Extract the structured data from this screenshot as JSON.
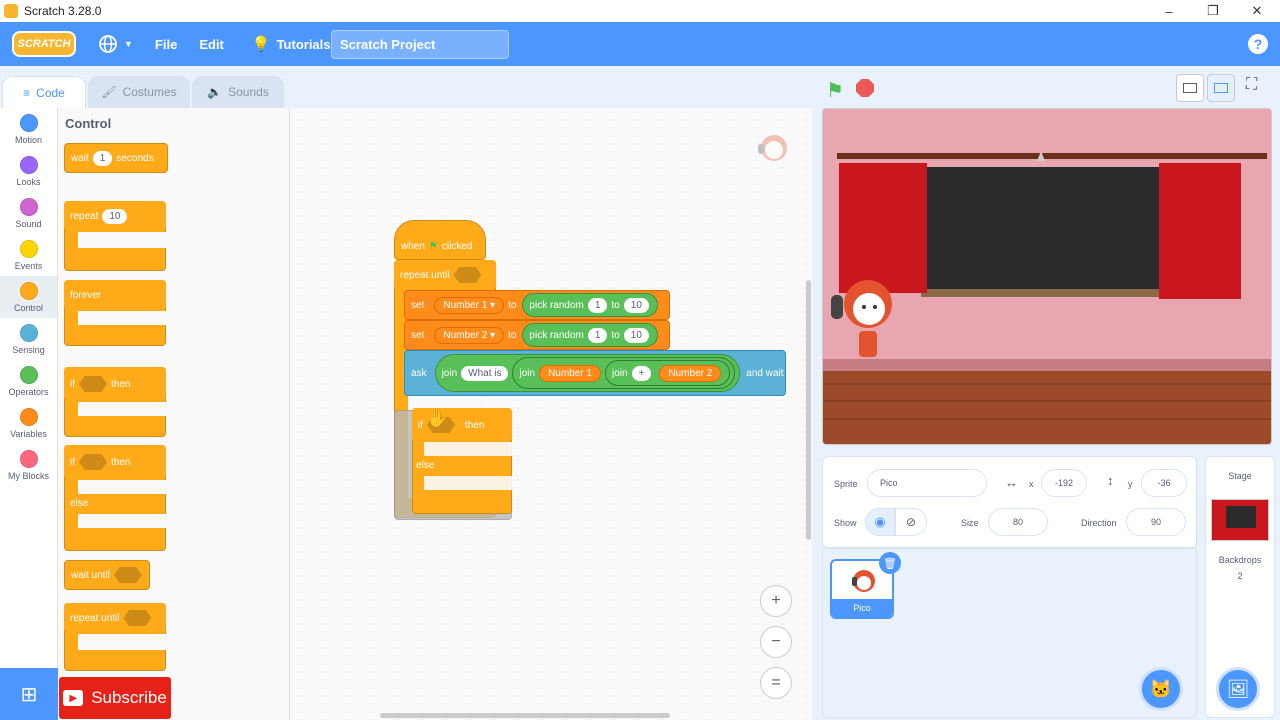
{
  "window": {
    "title": "Scratch 3.28.0",
    "min": "–",
    "max": "❐",
    "close": "✕"
  },
  "menu": {
    "logo": "SCRATCH",
    "file": "File",
    "edit": "Edit",
    "tutorials": "Tutorials",
    "project_title": "Scratch Project",
    "help": "?"
  },
  "tabs": {
    "code": "Code",
    "costumes": "Costumes",
    "sounds": "Sounds"
  },
  "categories": [
    {
      "label": "Motion",
      "color": "#4c97ff"
    },
    {
      "label": "Looks",
      "color": "#9966ff"
    },
    {
      "label": "Sound",
      "color": "#cf63cf"
    },
    {
      "label": "Events",
      "color": "#ffd500"
    },
    {
      "label": "Control",
      "color": "#ffab19"
    },
    {
      "label": "Sensing",
      "color": "#5cb1d6"
    },
    {
      "label": "Operators",
      "color": "#59c059"
    },
    {
      "label": "Variables",
      "color": "#ff8c1a"
    },
    {
      "label": "My Blocks",
      "color": "#ff6680"
    }
  ],
  "palette": {
    "title": "Control",
    "wait": "wait",
    "wait_val": "1",
    "seconds": "seconds",
    "repeat": "repeat",
    "repeat_val": "10",
    "forever": "forever",
    "if": "if",
    "then": "then",
    "if2": "if",
    "then2": "then",
    "else": "else",
    "wait_until": "wait until",
    "repeat_until": "repeat until"
  },
  "script": {
    "when": "when",
    "clicked": "clicked",
    "repeat_until": "repeat until",
    "set": "set",
    "var1": "Number 1 ▾",
    "to": "to",
    "pick_random": "pick random",
    "r1": "1",
    "r_to": "to",
    "r2": "10",
    "set2": "set",
    "var2": "Number 2 ▾",
    "to2": "to",
    "pick_random2": "pick random",
    "r3": "1",
    "r_to2": "to",
    "r4": "10",
    "ask": "ask",
    "join": "join",
    "what_is": "What is",
    "join2": "join",
    "number1": "Number 1",
    "join3": "join",
    "plus": "+",
    "number2": "Number 2",
    "and_wait": "and wait",
    "q": "?",
    "if": "if",
    "then": "then",
    "else": "else"
  },
  "sprite_info": {
    "sprite_label": "Sprite",
    "sprite_name": "Pico",
    "x_label": "x",
    "x": "-192",
    "y_label": "y",
    "y": "-36",
    "show_label": "Show",
    "size_label": "Size",
    "size": "80",
    "direction_label": "Direction",
    "direction": "90"
  },
  "sprite_thumb": {
    "name": "Pico"
  },
  "stage_panel": {
    "title": "Stage",
    "backdrops_label": "Backdrops",
    "backdrops_count": "2"
  },
  "subscribe": {
    "label": "Subscribe"
  },
  "zoom": {
    "in": "+",
    "out": "−",
    "reset": "="
  }
}
